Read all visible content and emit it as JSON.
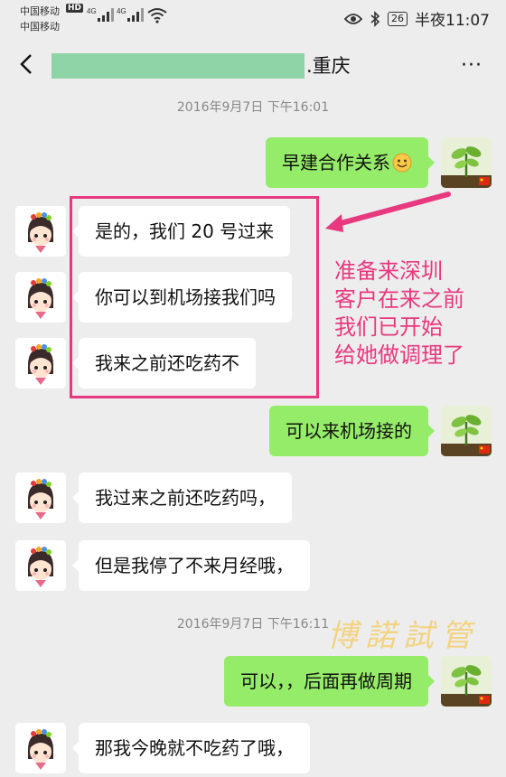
{
  "status_bar": {
    "carrier1": "中国移动",
    "hd": "HD",
    "carrier2": "中国移动",
    "net1": "4G",
    "net2": "4G",
    "battery": "26",
    "time": "半夜11:07"
  },
  "header": {
    "title_suffix": ".重庆",
    "more": "···"
  },
  "timestamps": [
    "2016年9月7日 下午16:01",
    "2016年9月7日 下午16:11"
  ],
  "messages": [
    {
      "side": "right",
      "text": "早建合作关系",
      "emoji": "smile"
    },
    {
      "side": "left",
      "text": "是的，我们 20 号过来"
    },
    {
      "side": "left",
      "text": "你可以到机场接我们吗"
    },
    {
      "side": "left",
      "text": "我来之前还吃药不"
    },
    {
      "side": "right",
      "text": "可以来机场接的"
    },
    {
      "side": "left",
      "text": "我过来之前还吃药吗，"
    },
    {
      "side": "left",
      "text": "但是我停了不来月经哦，"
    },
    {
      "side": "right",
      "text": "可以，，后面再做周期"
    },
    {
      "side": "left",
      "text": "那我今晚就不吃药了哦，"
    }
  ],
  "annotation": {
    "lines": [
      "准备来深圳",
      "客户在来之前",
      "我们已开始",
      "给她做调理了"
    ],
    "color": "#e8387f"
  },
  "watermark": "博諾試管",
  "colors": {
    "background": "#ededed",
    "sent_bubble": "#95ec69",
    "received_bubble": "#ffffff"
  }
}
